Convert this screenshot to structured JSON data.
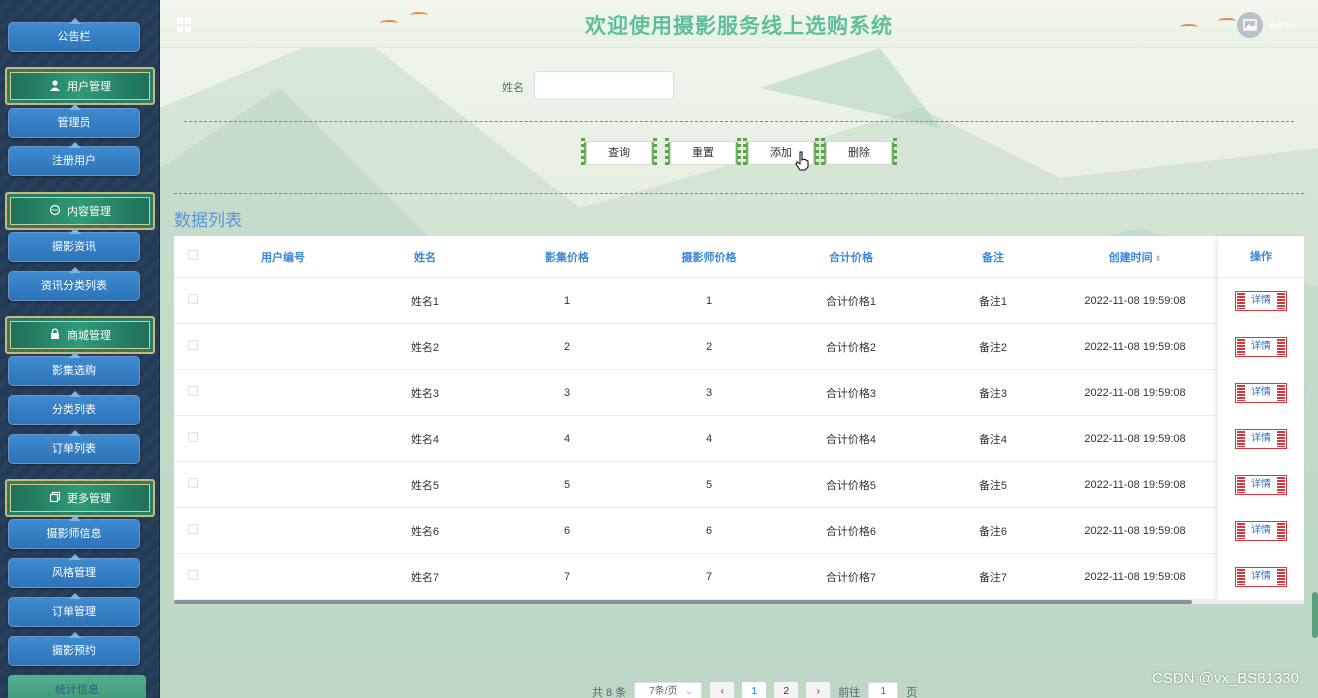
{
  "sidebar": {
    "items": [
      {
        "type": "sub",
        "label": "公告栏"
      },
      {
        "type": "head",
        "label": "用户管理",
        "icon": "user-icon"
      },
      {
        "type": "sub",
        "label": "管理员"
      },
      {
        "type": "sub",
        "label": "注册用户"
      },
      {
        "type": "head",
        "label": "内容管理",
        "icon": "chat-icon"
      },
      {
        "type": "sub",
        "label": "摄影资讯"
      },
      {
        "type": "sub",
        "label": "资讯分类列表"
      },
      {
        "type": "head",
        "label": "商城管理",
        "icon": "lock-icon"
      },
      {
        "type": "sub",
        "label": "影集选购"
      },
      {
        "type": "sub",
        "label": "分类列表"
      },
      {
        "type": "sub",
        "label": "订单列表"
      },
      {
        "type": "head",
        "label": "更多管理",
        "icon": "copy-icon"
      },
      {
        "type": "sub",
        "label": "摄影师信息"
      },
      {
        "type": "sub",
        "label": "风格管理"
      },
      {
        "type": "sub",
        "label": "订单管理"
      },
      {
        "type": "sub",
        "label": "摄影预约"
      }
    ],
    "last_label": "统计信息"
  },
  "header": {
    "title": "欢迎使用摄影服务线上选购系统",
    "user": "admin"
  },
  "search": {
    "label": "姓名",
    "value": "",
    "buttons": {
      "query": "查询",
      "reset": "重置",
      "add": "添加",
      "delete": "删除"
    }
  },
  "section_title": "数据列表",
  "table": {
    "headers": [
      "用户编号",
      "姓名",
      "影集价格",
      "摄影师价格",
      "合计价格",
      "备注",
      "创建时间",
      "操作"
    ],
    "detail_label": "详情",
    "rows": [
      {
        "id": "",
        "name": "姓名1",
        "album_price": "1",
        "photographer_price": "1",
        "total": "合计价格1",
        "note": "备注1",
        "created": "2022-11-08 19:59:08"
      },
      {
        "id": "",
        "name": "姓名2",
        "album_price": "2",
        "photographer_price": "2",
        "total": "合计价格2",
        "note": "备注2",
        "created": "2022-11-08 19:59:08"
      },
      {
        "id": "",
        "name": "姓名3",
        "album_price": "3",
        "photographer_price": "3",
        "total": "合计价格3",
        "note": "备注3",
        "created": "2022-11-08 19:59:08"
      },
      {
        "id": "",
        "name": "姓名4",
        "album_price": "4",
        "photographer_price": "4",
        "total": "合计价格4",
        "note": "备注4",
        "created": "2022-11-08 19:59:08"
      },
      {
        "id": "",
        "name": "姓名5",
        "album_price": "5",
        "photographer_price": "5",
        "total": "合计价格5",
        "note": "备注5",
        "created": "2022-11-08 19:59:08"
      },
      {
        "id": "",
        "name": "姓名6",
        "album_price": "6",
        "photographer_price": "6",
        "total": "合计价格6",
        "note": "备注6",
        "created": "2022-11-08 19:59:08"
      },
      {
        "id": "",
        "name": "姓名7",
        "album_price": "7",
        "photographer_price": "7",
        "total": "合计价格7",
        "note": "备注7",
        "created": "2022-11-08 19:59:08"
      }
    ]
  },
  "pagination": {
    "total_text": "共 8 条",
    "page_size": "7条/页",
    "pages": [
      "1",
      "2"
    ],
    "current_page": "1",
    "goto_label": "前往",
    "goto_value": "1",
    "page_suffix": "页"
  },
  "watermark": "CSDN @vx_BS81330",
  "colors": {
    "title": "#5fbf9a",
    "accent": "#3d88d6",
    "detail_border": "#d9363e",
    "sidebar_head": "#2f9a78"
  }
}
